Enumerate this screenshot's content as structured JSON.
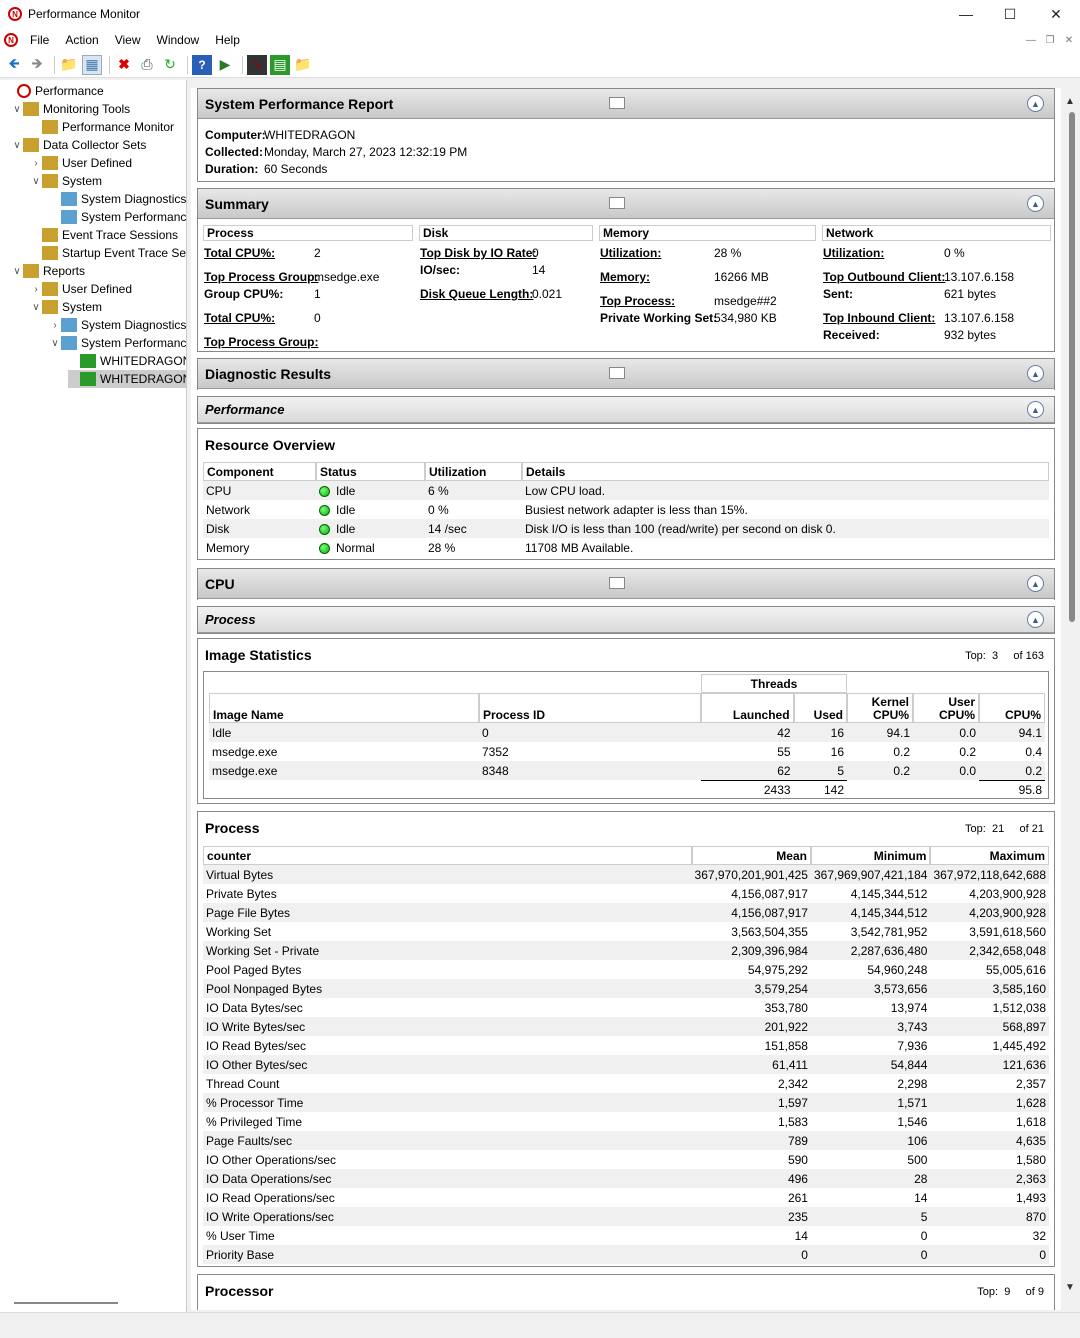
{
  "window": {
    "title": "Performance Monitor"
  },
  "menu": [
    "File",
    "Action",
    "View",
    "Window",
    "Help"
  ],
  "tree": [
    {
      "label": "Performance",
      "level": 0
    },
    {
      "label": "Monitoring Tools",
      "level": 1,
      "exp": "down"
    },
    {
      "label": "Performance Monitor",
      "level": 2
    },
    {
      "label": "Data Collector Sets",
      "level": 1,
      "exp": "down"
    },
    {
      "label": "User Defined",
      "level": 2,
      "exp": "right"
    },
    {
      "label": "System",
      "level": 2,
      "exp": "down"
    },
    {
      "label": "System Diagnostics",
      "level": 3
    },
    {
      "label": "System Performance",
      "level": 3
    },
    {
      "label": "Event Trace Sessions",
      "level": 2
    },
    {
      "label": "Startup Event Trace Sessions",
      "level": 2
    },
    {
      "label": "Reports",
      "level": 1,
      "exp": "down"
    },
    {
      "label": "User Defined",
      "level": 2,
      "exp": "right"
    },
    {
      "label": "System",
      "level": 2,
      "exp": "down"
    },
    {
      "label": "System Diagnostics",
      "level": 3,
      "exp": "right"
    },
    {
      "label": "System Performance",
      "level": 3,
      "exp": "down"
    },
    {
      "label": "WHITEDRAGON",
      "level": 4
    },
    {
      "label": "WHITEDRAGON",
      "level": 4,
      "selected": true
    }
  ],
  "report": {
    "title": "System Performance Report",
    "computer_label": "Computer:",
    "computer": "WHITEDRAGON",
    "collected_label": "Collected:",
    "collected": "Monday, March 27, 2023 12:32:19 PM",
    "duration_label": "Duration:",
    "duration": "60 Seconds"
  },
  "summary": {
    "title": "Summary",
    "process": {
      "head": "Process",
      "total_cpu_label": "Total CPU%:",
      "total_cpu": "2",
      "top_group_label": "Top Process Group:",
      "top_group": "msedge.exe",
      "group_cpu_label": "Group CPU%:",
      "group_cpu": "1",
      "total_cpu2_label": "Total CPU%:",
      "total_cpu2": "0",
      "top_group2_label": "Top Process Group:"
    },
    "disk": {
      "head": "Disk",
      "top_disk_label": "Top Disk by IO Rate:",
      "top_disk": "0",
      "io_label": "IO/sec:",
      "io": "14",
      "queue_label": "Disk Queue Length:",
      "queue": "0.021"
    },
    "memory": {
      "head": "Memory",
      "util_label": "Utilization:",
      "util": "28 %",
      "mem_label": "Memory:",
      "mem": "16266 MB",
      "top_proc_label": "Top Process:",
      "top_proc": "msedge##2",
      "pws_label": "Private Working Set:",
      "pws": "534,980 KB"
    },
    "network": {
      "head": "Network",
      "util_label": "Utilization:",
      "util": "0 %",
      "out_label": "Top Outbound Client:",
      "out": "13.107.6.158",
      "sent_label": "Sent:",
      "sent": "621 bytes",
      "in_label": "Top Inbound Client:",
      "in": "13.107.6.158",
      "recv_label": "Received:",
      "recv": "932 bytes"
    }
  },
  "diagnostic": {
    "title": "Diagnostic Results",
    "performance": "Performance"
  },
  "resource": {
    "title": "Resource Overview",
    "headers": [
      "Component",
      "Status",
      "Utilization",
      "Details"
    ],
    "rows": [
      [
        "CPU",
        "Idle",
        "6 %",
        "Low CPU load."
      ],
      [
        "Network",
        "Idle",
        "0 %",
        "Busiest network adapter is less than 15%."
      ],
      [
        "Disk",
        "Idle",
        "14 /sec",
        "Disk I/O is less than 100 (read/write) per second on disk 0."
      ],
      [
        "Memory",
        "Normal",
        "28 %",
        "11708 MB Available."
      ]
    ]
  },
  "cpu": {
    "title": "CPU",
    "process": "Process"
  },
  "image_stats": {
    "title": "Image Statistics",
    "top_label": "Top:",
    "top": "3",
    "of_label": "of",
    "of": "163",
    "threads_label": "Threads",
    "headers": [
      "Image Name",
      "Process ID",
      "Launched",
      "Used",
      "Kernel CPU%",
      "User CPU%",
      "CPU%"
    ],
    "rows": [
      [
        "Idle",
        "0",
        "42",
        "16",
        "94.1",
        "0.0",
        "94.1"
      ],
      [
        "msedge.exe",
        "7352",
        "55",
        "16",
        "0.2",
        "0.2",
        "0.4"
      ],
      [
        "msedge.exe",
        "8348",
        "62",
        "5",
        "0.2",
        "0.0",
        "0.2"
      ]
    ],
    "totals": [
      "",
      "",
      "2433",
      "142",
      "",
      "",
      "95.8"
    ]
  },
  "process_stats": {
    "title": "Process",
    "top_label": "Top:",
    "top": "21",
    "of_label": "of",
    "of": "21",
    "headers": [
      "counter",
      "Mean",
      "Minimum",
      "Maximum"
    ],
    "rows": [
      [
        "Virtual Bytes",
        "367,970,201,901,425",
        "367,969,907,421,184",
        "367,972,118,642,688"
      ],
      [
        "Private Bytes",
        "4,156,087,917",
        "4,145,344,512",
        "4,203,900,928"
      ],
      [
        "Page File Bytes",
        "4,156,087,917",
        "4,145,344,512",
        "4,203,900,928"
      ],
      [
        "Working Set",
        "3,563,504,355",
        "3,542,781,952",
        "3,591,618,560"
      ],
      [
        "Working Set - Private",
        "2,309,396,984",
        "2,287,636,480",
        "2,342,658,048"
      ],
      [
        "Pool Paged Bytes",
        "54,975,292",
        "54,960,248",
        "55,005,616"
      ],
      [
        "Pool Nonpaged Bytes",
        "3,579,254",
        "3,573,656",
        "3,585,160"
      ],
      [
        "IO Data Bytes/sec",
        "353,780",
        "13,974",
        "1,512,038"
      ],
      [
        "IO Write Bytes/sec",
        "201,922",
        "3,743",
        "568,897"
      ],
      [
        "IO Read Bytes/sec",
        "151,858",
        "7,936",
        "1,445,492"
      ],
      [
        "IO Other Bytes/sec",
        "61,411",
        "54,844",
        "121,636"
      ],
      [
        "Thread Count",
        "2,342",
        "2,298",
        "2,357"
      ],
      [
        "% Processor Time",
        "1,597",
        "1,571",
        "1,628"
      ],
      [
        "% Privileged Time",
        "1,583",
        "1,546",
        "1,618"
      ],
      [
        "Page Faults/sec",
        "789",
        "106",
        "4,635"
      ],
      [
        "IO Other Operations/sec",
        "590",
        "500",
        "1,580"
      ],
      [
        "IO Data Operations/sec",
        "496",
        "28",
        "2,363"
      ],
      [
        "IO Read Operations/sec",
        "261",
        "14",
        "1,493"
      ],
      [
        "IO Write Operations/sec",
        "235",
        "5",
        "870"
      ],
      [
        "% User Time",
        "14",
        "0",
        "32"
      ],
      [
        "Priority Base",
        "0",
        "0",
        "0"
      ]
    ]
  },
  "processor": {
    "title": "Processor",
    "top_label": "Top:",
    "top": "9",
    "of_label": "of",
    "of": "9"
  }
}
